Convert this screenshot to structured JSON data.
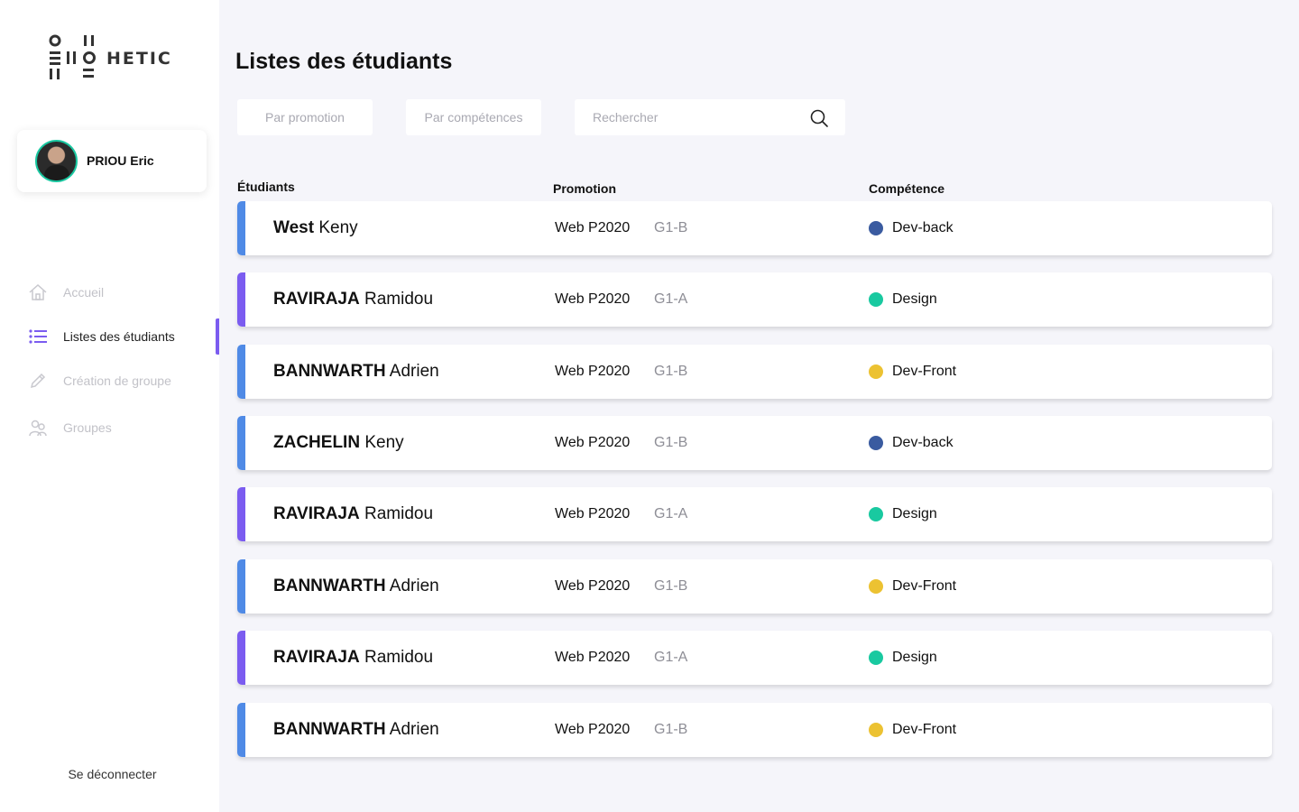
{
  "brand": {
    "name": "HETIC"
  },
  "profile": {
    "name": "PRIOU Eric"
  },
  "nav": {
    "items": [
      {
        "label": "Accueil",
        "icon": "home-icon",
        "active": false
      },
      {
        "label": "Listes des étudiants",
        "icon": "list-icon",
        "active": true
      },
      {
        "label": "Création de groupe",
        "icon": "pencil-icon",
        "active": false
      },
      {
        "label": "Groupes",
        "icon": "users-icon",
        "active": false
      }
    ],
    "logout": "Se déconnecter"
  },
  "page": {
    "title": "Listes des étudiants"
  },
  "filters": {
    "promotion": "Par promotion",
    "competences": "Par compétences",
    "search_placeholder": "Rechercher"
  },
  "table": {
    "headers": {
      "students": "Étudiants",
      "promotion": "Promotion",
      "competence": "Compétence"
    },
    "rows": [
      {
        "last": "West",
        "first": "Keny",
        "promo": "Web P2020",
        "group": "G1-B",
        "skill": "Dev-back",
        "skill_color": "#3a5ba0",
        "bar_color": "#4f8ae6"
      },
      {
        "last": "RAVIRAJA",
        "first": "Ramidou",
        "promo": "Web P2020",
        "group": "G1-A",
        "skill": "Design",
        "skill_color": "#19c9a0",
        "bar_color": "#7b5cf0"
      },
      {
        "last": "BANNWARTH",
        "first": "Adrien",
        "promo": "Web P2020",
        "group": "G1-B",
        "skill": "Dev-Front",
        "skill_color": "#ecc232",
        "bar_color": "#4f8ae6"
      },
      {
        "last": "ZACHELIN",
        "first": "Keny",
        "promo": "Web P2020",
        "group": "G1-B",
        "skill": "Dev-back",
        "skill_color": "#3a5ba0",
        "bar_color": "#4f8ae6"
      },
      {
        "last": "RAVIRAJA",
        "first": "Ramidou",
        "promo": "Web P2020",
        "group": "G1-A",
        "skill": "Design",
        "skill_color": "#19c9a0",
        "bar_color": "#7b5cf0"
      },
      {
        "last": "BANNWARTH",
        "first": "Adrien",
        "promo": "Web P2020",
        "group": "G1-B",
        "skill": "Dev-Front",
        "skill_color": "#ecc232",
        "bar_color": "#4f8ae6"
      },
      {
        "last": "RAVIRAJA",
        "first": "Ramidou",
        "promo": "Web P2020",
        "group": "G1-A",
        "skill": "Design",
        "skill_color": "#19c9a0",
        "bar_color": "#7b5cf0"
      },
      {
        "last": "BANNWARTH",
        "first": "Adrien",
        "promo": "Web P2020",
        "group": "G1-B",
        "skill": "Dev-Front",
        "skill_color": "#ecc232",
        "bar_color": "#4f8ae6"
      }
    ]
  },
  "colors": {
    "accent": "#7b5cf0",
    "background": "#f5f5fa"
  }
}
